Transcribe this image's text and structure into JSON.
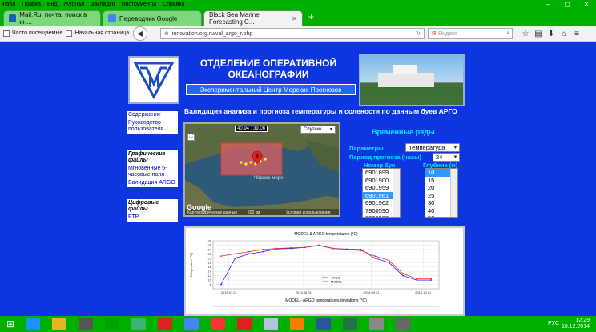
{
  "menu": [
    "Файл",
    "Правка",
    "Вид",
    "Журнал",
    "Закладки",
    "Инструменты",
    "Справка"
  ],
  "tabs": [
    {
      "label": "Mail.Ru: почта, поиск в ин...",
      "color": "#1a5fb4"
    },
    {
      "label": "Переводчик Google",
      "color": "#4285f4"
    },
    {
      "label": "Black Sea Marine Forecasting C...",
      "color": "#0d36e0"
    }
  ],
  "bookmarks": [
    "Часто посещаемые",
    "Начальная страница"
  ],
  "url": "innovation.org.ru/val_argo_r.php",
  "search_placeholder": "Яндекс",
  "header": {
    "title": "ОТДЕЛЕНИЕ ОПЕРАТИВНОЙ ОКЕАНОГРАФИИ",
    "subtitle": "Экспериментальный Центр Морских Прогнозов"
  },
  "page_heading": "Валидация анализа и прогноза температуры и солености по данным буев АРГО",
  "sidebar": {
    "links1": [
      "Содержание",
      "Руководство пользователя"
    ],
    "head1": "Графические файлы",
    "links2": [
      "Мгновенные 6-часовые поля",
      "Валидация ARGO"
    ],
    "head2": "Цифровые файлы",
    "links3": [
      "FTP"
    ]
  },
  "map": {
    "coord": "40.94 : 39.06",
    "type": "Спутник",
    "sea_label": "Чёрное море",
    "brand": "Google",
    "footer": "Картографические данные",
    "scale": "200 км",
    "terms": "Условия использования"
  },
  "timeseries": {
    "title": "Временные ряды",
    "params_label": "Параметры",
    "param_value": "Температура",
    "period_label": "Период прогноза (часы)",
    "period_value": "24",
    "buoy_label": "Номер буя",
    "depth_label": "Глубина (м)",
    "buoys": [
      "6901899",
      "6901900",
      "6901959",
      "6901961",
      "6901962",
      "7900590",
      "7900593"
    ],
    "selected_buoy": "6901961",
    "depths": [
      "10",
      "15",
      "20",
      "25",
      "30",
      "40",
      "50"
    ],
    "selected_depth": "10"
  },
  "chart_data": {
    "type": "line",
    "title": "MODEL & ARGO temperatures (°C)",
    "ylabel": "Temperature (°C)",
    "xlabel": "",
    "ylim": [
      6,
      28
    ],
    "y_ticks": [
      "8",
      "10",
      "12",
      "14",
      "16",
      "18",
      "20",
      "22",
      "24",
      "26",
      "28"
    ],
    "x_ticks": [
      "2014.07.01",
      "2014.08.01",
      "2014.09.01",
      "2014.10.01"
    ],
    "x_tick_positions": [
      0.07,
      0.4,
      0.7,
      0.93
    ],
    "series": [
      {
        "name": "ARGO",
        "color": "#2222ff",
        "values": [
          8,
          20,
          22,
          23,
          24.3,
          24.5,
          25,
          25.8,
          24.5,
          24.2,
          24,
          20,
          18,
          12,
          10,
          10
        ]
      },
      {
        "name": "MODEL",
        "color": "#ff2222",
        "values": [
          21,
          22,
          23,
          24,
          24.5,
          24.8,
          25,
          26,
          24.5,
          24,
          23.5,
          21,
          19,
          13,
          10.5,
          10.5
        ]
      }
    ],
    "second_title": "MODEL - ARGO temperatures deviations (°C)"
  },
  "taskbar": {
    "lang": "РУС",
    "time": "12:29",
    "date": "10.12.2014",
    "icons": [
      "#1e90ff",
      "#e6b422",
      "#555555",
      "#00a000",
      "#3cb371",
      "#d22",
      "#4285f4",
      "#ff3333",
      "#e02020",
      "#b0c4de",
      "#ff7a00",
      "#2b579a",
      "#217346",
      "#888888",
      "#666666"
    ]
  }
}
